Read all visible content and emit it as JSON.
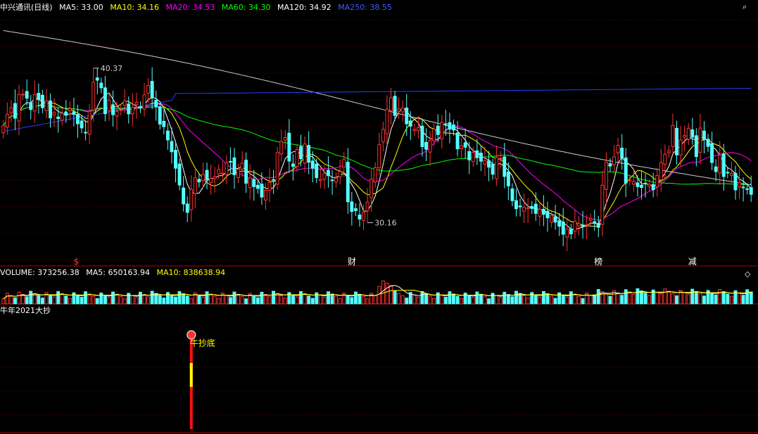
{
  "header": {
    "title": "中兴通讯(日线)",
    "ma": [
      {
        "label": "MA5: 33.00",
        "color": "#ffffff"
      },
      {
        "label": "MA10: 34.16",
        "color": "#ffff00"
      },
      {
        "label": "MA20: 34.53",
        "color": "#ff00ff"
      },
      {
        "label": "MA60: 34.30",
        "color": "#00ff00"
      },
      {
        "label": "MA120: 34.92",
        "color": "#ffffff"
      },
      {
        "label": "MA250: 38.55",
        "color": "#0000ff"
      }
    ]
  },
  "volume_header": {
    "title": "VOLUME: 373256.38",
    "ma5": "MA5: 650163.94",
    "ma10": "MA10: 838638.94"
  },
  "indicator_header": {
    "title": "牛年2021大抄"
  },
  "indicator": {
    "signal_label": "牛抄底",
    "signal_index": 48
  },
  "markers": [
    {
      "index": 19,
      "label": "$",
      "color": "#ff3030"
    },
    {
      "index": 89,
      "label": "财",
      "color": "#ffffff"
    },
    {
      "index": 152,
      "label": "榜",
      "color": "#ffffff"
    },
    {
      "index": 176,
      "label": "减",
      "color": "#ffffff"
    }
  ],
  "annotations": [
    {
      "index": 23,
      "label": "40.37"
    },
    {
      "index": 93,
      "label": "30.16"
    }
  ],
  "corner_icons": [
    "search-icon",
    "diamond-icon"
  ],
  "colors": {
    "up": "#ff3232",
    "down": "#54ffff",
    "grid": "#7a0000",
    "axis": "#b00000"
  },
  "chart_data": {
    "type": "candlestick",
    "series_count": 186,
    "close_markers": [
      40.37,
      30.16
    ],
    "ylim_main": [
      29.2,
      42.4
    ],
    "closes": [
      36.52,
      37.15,
      37.51,
      36.93,
      38.25,
      38.26,
      38.04,
      37.41,
      38.24,
      37.97,
      37.51,
      37.89,
      36.95,
      37.24,
      36.91,
      37.2,
      37.1,
      37.45,
      37.14,
      36.62,
      36.39,
      36.12,
      37.31,
      38.93,
      39.04,
      38.62,
      37.18,
      37.92,
      37.13,
      37.31,
      37.4,
      37.88,
      37.17,
      37.53,
      37.81,
      37.52,
      38.23,
      38.74,
      38.09,
      37.57,
      36.6,
      36.46,
      35.72,
      35.07,
      34.15,
      33.22,
      32.17,
      31.7,
      32.98,
      33.62,
      33.39,
      33.8,
      33.52,
      33.58,
      33.68,
      34.08,
      33.89,
      34.45,
      34.49,
      33.79,
      34.1,
      34.44,
      33.32,
      33.61,
      33.13,
      33.03,
      32.55,
      32.93,
      33.36,
      33.51,
      35.03,
      35.64,
      35.86,
      34.55,
      34.25,
      35.19,
      34.68,
      35.5,
      34.48,
      34.15,
      33.63,
      33.54,
      33.88,
      33.74,
      33.46,
      33.6,
      33.97,
      34.65,
      32.29,
      31.75,
      31.8,
      31.33,
      31.71,
      32.27,
      33.55,
      34.18,
      35.46,
      36.31,
      37.43,
      38.07,
      37.08,
      37.44,
      37.5,
      36.62,
      36.49,
      36.32,
      36.41,
      35.35,
      35.21,
      35.69,
      36.33,
      36.02,
      36.7,
      36.61,
      36.32,
      36.27,
      35.23,
      35.41,
      35.32,
      34.61,
      35.04,
      34.75,
      34.54,
      34.57,
      34.21,
      33.82,
      34.75,
      34.7,
      33.7,
      33.17,
      32.35,
      31.9,
      32.01,
      31.98,
      31.95,
      31.92,
      31.65,
      31.88,
      31.6,
      31.4,
      31.54,
      31.16,
      30.93,
      30.49,
      30.77,
      30.51,
      31.2,
      31.08,
      30.91,
      31.02,
      31.35,
      31.09,
      30.87,
      33.21,
      34.49,
      34.27,
      34.78,
      35.43,
      34.73,
      33.33,
      33.5,
      33.42,
      33.13,
      33.08,
      33.31,
      33.25,
      32.96,
      33.75,
      34.46,
      34.93,
      35.12,
      36.53,
      34.89,
      35.72,
      35.98,
      36.37,
      35.88,
      34.8,
      36.38,
      35.76,
      35.36,
      34.47,
      33.97,
      34.88,
      33.69,
      33.91,
      33.87,
      32.95,
      33.35,
      33.09,
      33.0,
      32.7
    ],
    "volume_ylim": [
      0,
      100
    ]
  }
}
